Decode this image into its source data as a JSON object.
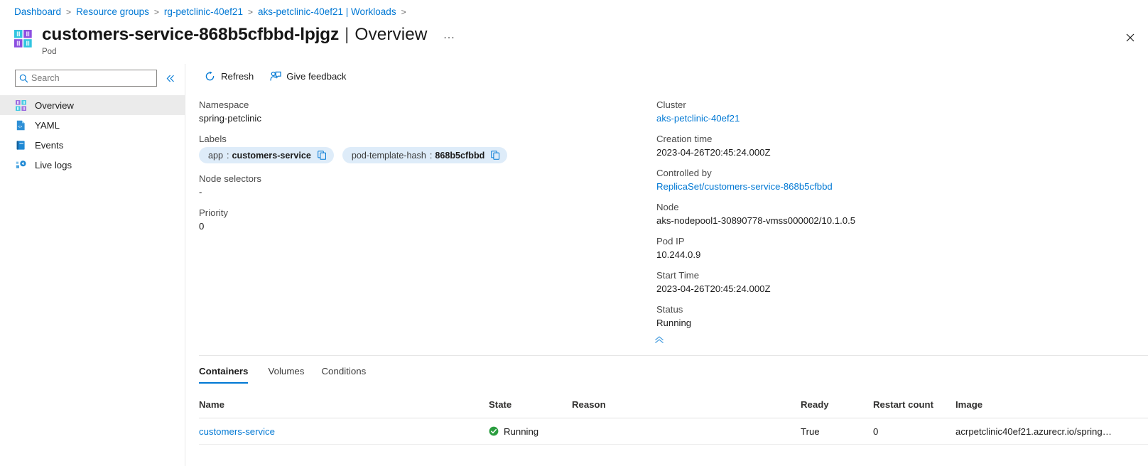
{
  "breadcrumb": {
    "items": [
      {
        "label": "Dashboard"
      },
      {
        "label": "Resource groups"
      },
      {
        "label": "rg-petclinic-40ef21"
      },
      {
        "label": "aks-petclinic-40ef21 | Workloads"
      }
    ],
    "separator": ">"
  },
  "header": {
    "title": "customers-service-868b5cfbbd-lpjgz",
    "divider": "|",
    "section": "Overview",
    "subtitle": "Pod",
    "more_label": "…",
    "close_label": "✕",
    "icon": "pod-icon"
  },
  "sidebar": {
    "search": {
      "placeholder": "Search",
      "value": "",
      "icon": "search-icon"
    },
    "collapse": {
      "label": "«",
      "icon": "chevron-double-left-icon"
    },
    "items": [
      {
        "label": "Overview",
        "icon": "overview-grid-icon",
        "selected": true
      },
      {
        "label": "YAML",
        "icon": "yaml-file-icon",
        "selected": false
      },
      {
        "label": "Events",
        "icon": "events-book-icon",
        "selected": false
      },
      {
        "label": "Live logs",
        "icon": "live-logs-icon",
        "selected": false
      }
    ]
  },
  "commandbar": {
    "buttons": [
      {
        "label": "Refresh",
        "icon": "refresh-icon"
      },
      {
        "label": "Give feedback",
        "icon": "feedback-person-icon"
      }
    ]
  },
  "properties": {
    "left": [
      {
        "label": "Namespace",
        "value": "spring-petclinic",
        "type": "text"
      },
      {
        "label": "Labels",
        "type": "chips"
      },
      {
        "label": "Node selectors",
        "value": "-",
        "type": "text"
      },
      {
        "label": "Priority",
        "value": "0",
        "type": "text"
      }
    ],
    "labels_chips": [
      {
        "key": "app",
        "sep": ":",
        "value": "customers-service",
        "copy_icon": "copy-icon"
      },
      {
        "key": "pod-template-hash",
        "sep": ":",
        "value": "868b5cfbbd",
        "copy_icon": "copy-icon"
      }
    ],
    "right": [
      {
        "label": "Cluster",
        "value": "aks-petclinic-40ef21",
        "type": "link"
      },
      {
        "label": "Creation time",
        "value": "2023-04-26T20:45:24.000Z",
        "type": "text"
      },
      {
        "label": "Controlled by",
        "value": "ReplicaSet/customers-service-868b5cfbbd",
        "type": "link"
      },
      {
        "label": "Node",
        "value": "aks-nodepool1-30890778-vmss000002/10.1.0.5",
        "type": "text"
      },
      {
        "label": "Pod IP",
        "value": "10.244.0.9",
        "type": "text"
      },
      {
        "label": "Start Time",
        "value": "2023-04-26T20:45:24.000Z",
        "type": "text"
      },
      {
        "label": "Status",
        "value": "Running",
        "type": "text"
      }
    ],
    "collapse_up": {
      "icon": "chevron-double-up-icon"
    }
  },
  "tabs": [
    {
      "label": "Containers",
      "active": true
    },
    {
      "label": "Volumes",
      "active": false
    },
    {
      "label": "Conditions",
      "active": false
    }
  ],
  "table": {
    "columns": [
      "Name",
      "State",
      "Reason",
      "Ready",
      "Restart count",
      "Image"
    ],
    "rows": [
      {
        "name": "customers-service",
        "state": "Running",
        "state_icon": "status-ok-icon",
        "reason": "",
        "ready": "True",
        "restart_count": "0",
        "image": "acrpetclinic40ef21.azurecr.io/spring…"
      }
    ]
  },
  "colors": {
    "accent": "#0078d4",
    "chip_bg": "#deecf9",
    "status_ok": "#2a9d3f",
    "nav_selected": "#ebebeb",
    "pod_cyan": "#32c5e0",
    "pod_purple": "#8c4fe0"
  }
}
